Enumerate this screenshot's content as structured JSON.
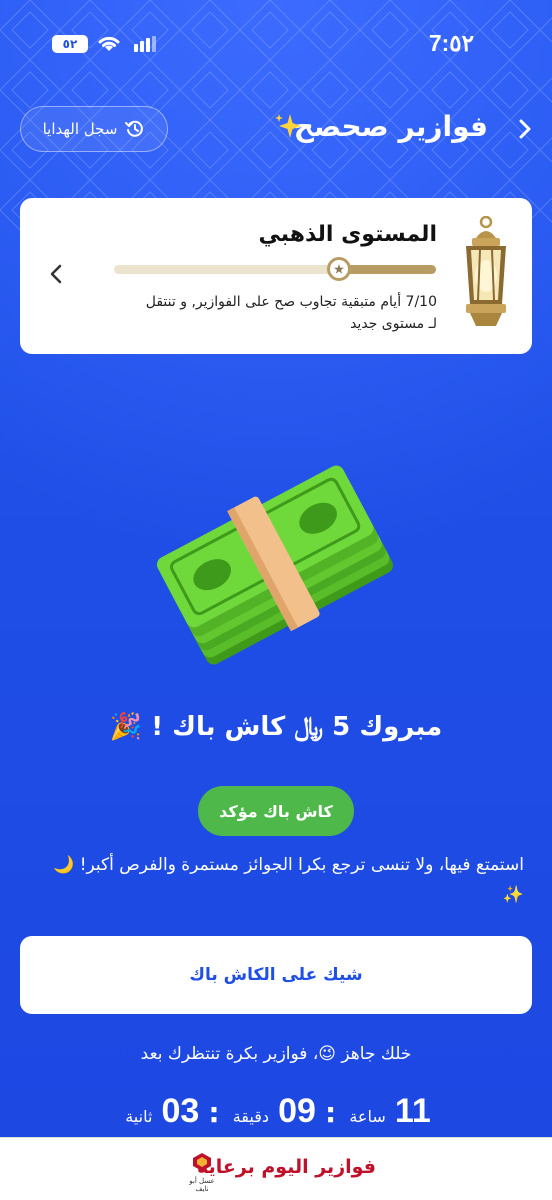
{
  "status_bar": {
    "time": "7:٥٢",
    "battery": "٥٢"
  },
  "header": {
    "title": "فوازير صحصح",
    "gift_log_label": "سجل الهدايا"
  },
  "level_card": {
    "title": "المستوى الذهبي",
    "description": "7/10 أيام متبقية تجاوب صح على الفوازير, و تنتقل لـ مستوى جديد",
    "progress": 0.3
  },
  "reward": {
    "congrats": "مبروك 5 ﷼ كاش باك ! 🎉",
    "confirmed_label": "كاش باك مؤكد",
    "enjoy_text": "استمتع فيها، ولا تنسى ترجع بكرا الجوائز مستمرة والفرص أكبر! 🌙 ✨",
    "check_cashback_label": "شيك على الكاش باك"
  },
  "countdown": {
    "ready_text": "خلك جاهز 😉، فوازير بكرة تنتظرك بعد",
    "hours": "11",
    "hours_unit": "ساعة",
    "minutes": "09",
    "minutes_unit": "دقيقة",
    "seconds": "03",
    "seconds_unit": "ثانية"
  },
  "bottom_bar": {
    "sponsor_text": "فوازير اليوم برعاية",
    "sponsor_logo_text": "عسل أبو نايف"
  },
  "colors": {
    "primary": "#1f4fe6",
    "success": "#4fb84a",
    "gold": "#b79c63",
    "sponsor": "#c0102a"
  }
}
